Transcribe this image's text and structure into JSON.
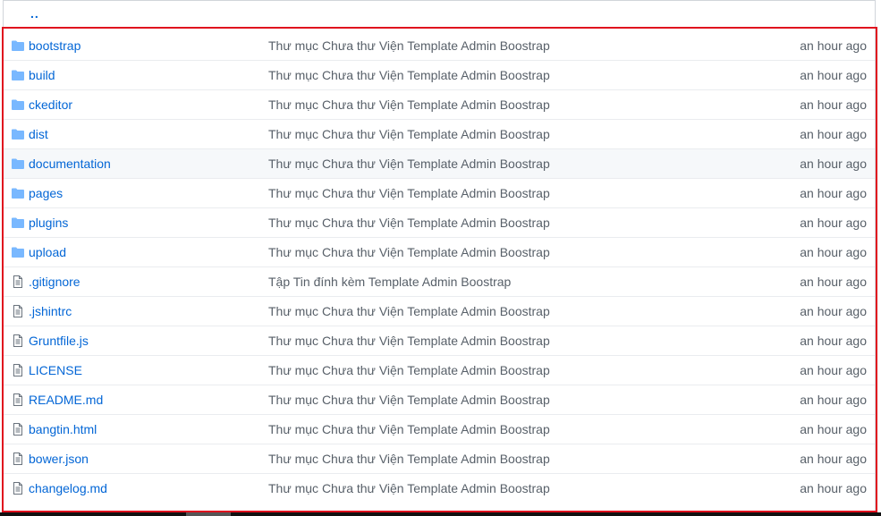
{
  "parent_link": "..",
  "colors": {
    "link": "#0366d6",
    "muted": "#586069",
    "folder_icon": "#79b8ff",
    "file_icon": "#6a737d",
    "highlight": "#e0101e"
  },
  "rows": [
    {
      "type": "folder",
      "icon": "folder-icon",
      "name": "bootstrap",
      "message": "Thư mục Chưa thư Viện Template Admin Boostrap",
      "age": "an hour ago"
    },
    {
      "type": "folder",
      "icon": "folder-icon",
      "name": "build",
      "message": "Thư mục Chưa thư Viện Template Admin Boostrap",
      "age": "an hour ago"
    },
    {
      "type": "folder",
      "icon": "folder-icon",
      "name": "ckeditor",
      "message": "Thư mục Chưa thư Viện Template Admin Boostrap",
      "age": "an hour ago"
    },
    {
      "type": "folder",
      "icon": "folder-icon",
      "name": "dist",
      "message": "Thư mục Chưa thư Viện Template Admin Boostrap",
      "age": "an hour ago"
    },
    {
      "type": "folder",
      "icon": "folder-icon",
      "name": "documentation",
      "message": "Thư mục Chưa thư Viện Template Admin Boostrap",
      "age": "an hour ago"
    },
    {
      "type": "folder",
      "icon": "folder-icon",
      "name": "pages",
      "message": "Thư mục Chưa thư Viện Template Admin Boostrap",
      "age": "an hour ago"
    },
    {
      "type": "folder",
      "icon": "folder-icon",
      "name": "plugins",
      "message": "Thư mục Chưa thư Viện Template Admin Boostrap",
      "age": "an hour ago"
    },
    {
      "type": "folder",
      "icon": "folder-icon",
      "name": "upload",
      "message": "Thư mục Chưa thư Viện Template Admin Boostrap",
      "age": "an hour ago"
    },
    {
      "type": "file",
      "icon": "file-icon",
      "name": ".gitignore",
      "message": "Tập Tin đính kèm Template Admin Boostrap",
      "age": "an hour ago"
    },
    {
      "type": "file",
      "icon": "file-icon",
      "name": ".jshintrc",
      "message": "Thư mục Chưa thư Viện Template Admin Boostrap",
      "age": "an hour ago"
    },
    {
      "type": "file",
      "icon": "file-icon",
      "name": "Gruntfile.js",
      "message": "Thư mục Chưa thư Viện Template Admin Boostrap",
      "age": "an hour ago"
    },
    {
      "type": "file",
      "icon": "file-icon",
      "name": "LICENSE",
      "message": "Thư mục Chưa thư Viện Template Admin Boostrap",
      "age": "an hour ago"
    },
    {
      "type": "file",
      "icon": "file-icon",
      "name": "README.md",
      "message": "Thư mục Chưa thư Viện Template Admin Boostrap",
      "age": "an hour ago"
    },
    {
      "type": "file",
      "icon": "file-icon",
      "name": "bangtin.html",
      "message": "Thư mục Chưa thư Viện Template Admin Boostrap",
      "age": "an hour ago"
    },
    {
      "type": "file",
      "icon": "file-icon",
      "name": "bower.json",
      "message": "Thư mục Chưa thư Viện Template Admin Boostrap",
      "age": "an hour ago"
    },
    {
      "type": "file",
      "icon": "file-icon",
      "name": "changelog.md",
      "message": "Thư mục Chưa thư Viện Template Admin Boostrap",
      "age": "an hour ago"
    }
  ]
}
